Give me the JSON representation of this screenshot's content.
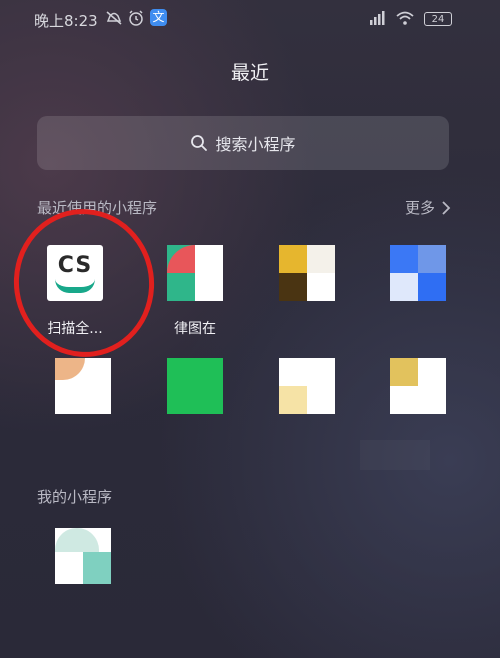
{
  "status_bar": {
    "time": "晚上8:23",
    "app_badge_glyph": "文",
    "battery": "24"
  },
  "header": {
    "title": "最近"
  },
  "search": {
    "label": "搜索小程序"
  },
  "recent": {
    "title": "最近使用的小程序",
    "more_label": "更多",
    "apps": [
      {
        "label": "扫描全...",
        "icon": "camscanner-icon"
      },
      {
        "label": "律图在",
        "icon": "app-icon-2"
      },
      {
        "label": "",
        "icon": "app-icon-3"
      },
      {
        "label": "",
        "icon": "app-icon-4"
      },
      {
        "label": "",
        "icon": "app-icon-5"
      },
      {
        "label": "",
        "icon": "app-icon-6"
      },
      {
        "label": "",
        "icon": "app-icon-7"
      },
      {
        "label": "",
        "icon": "app-icon-8"
      }
    ]
  },
  "mine": {
    "title": "我的小程序",
    "apps": [
      {
        "label": "",
        "icon": "app-icon-mine-1"
      }
    ]
  },
  "cs_icon_text": "CS",
  "colors": {
    "annotation_red": "#e1201e",
    "cs_green": "#18a88a",
    "accent_blue": "#3b78f5",
    "accent_green": "#1fbf57"
  }
}
